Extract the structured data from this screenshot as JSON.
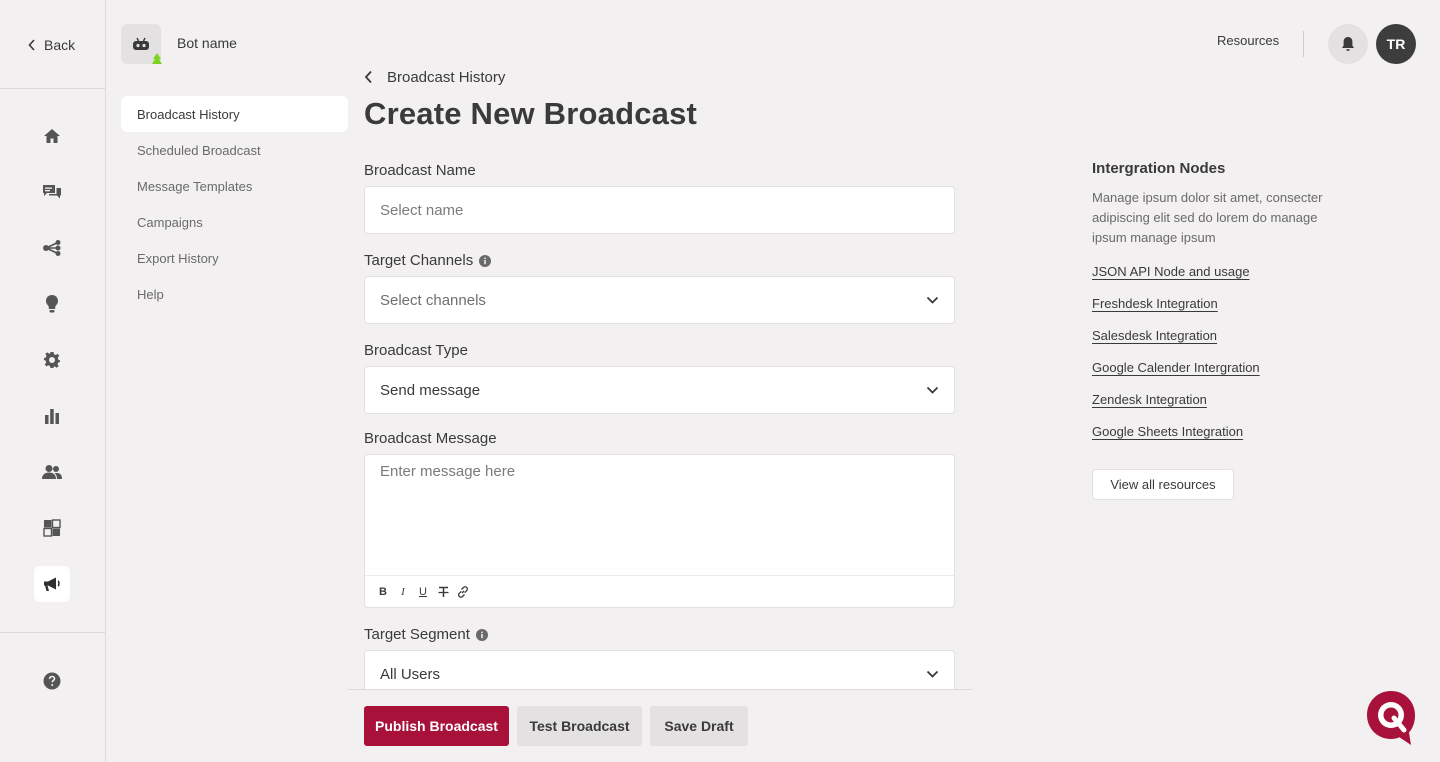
{
  "nav": {
    "back_label": "Back",
    "rail_icons": [
      "home-icon",
      "chat-icon",
      "flow-icon",
      "bulb-icon",
      "gear-icon",
      "bar-chart-icon",
      "users-icon",
      "integration-icon",
      "megaphone-icon"
    ],
    "help_icon": "help-icon",
    "active": "megaphone-icon"
  },
  "bot": {
    "name": "Bot name"
  },
  "subnav": {
    "items": [
      {
        "label": "Broadcast History",
        "active": true
      },
      {
        "label": "Scheduled Broadcast"
      },
      {
        "label": "Message Templates"
      },
      {
        "label": "Campaigns"
      },
      {
        "label": "Export History"
      },
      {
        "label": "Help"
      }
    ]
  },
  "header": {
    "resources_label": "Resources",
    "user_initials": "TR"
  },
  "breadcrumb": {
    "label": "Broadcast History"
  },
  "page": {
    "title": "Create New Broadcast"
  },
  "form": {
    "name_label": "Broadcast Name",
    "name_placeholder": "Select name",
    "channels_label": "Target Channels",
    "channels_placeholder": "Select channels",
    "type_label": "Broadcast Type",
    "type_value": "Send message",
    "message_label": "Broadcast Message",
    "message_placeholder": "Enter message here",
    "segment_label": "Target Segment",
    "segment_value": "All Users"
  },
  "actions": {
    "publish": "Publish Broadcast",
    "test": "Test Broadcast",
    "draft": "Save Draft"
  },
  "resources_panel": {
    "title": "Intergration Nodes",
    "description": "Manage ipsum dolor sit amet, consecter adipiscing elit sed do lorem do manage ipsum manage ipsum",
    "links": [
      "JSON API Node and usage",
      "Freshdesk Integration",
      "Salesdesk Integration",
      "Google Calender Intergration",
      "Zendesk Integration",
      "Google Sheets Integration"
    ],
    "view_all": "View all resources"
  },
  "colors": {
    "accent": "#a8123a",
    "background": "#f2f0f1",
    "bot_status": "#7ed321"
  }
}
